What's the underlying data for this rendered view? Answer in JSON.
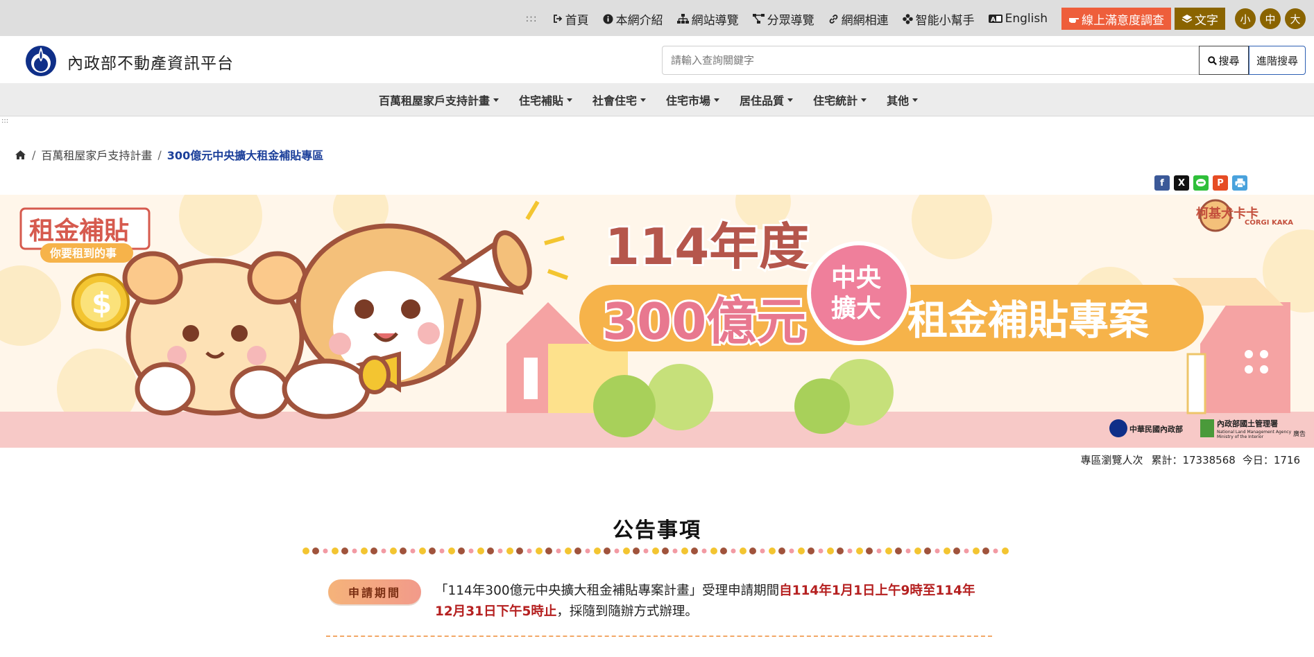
{
  "topbar": {
    "sep": ":::",
    "links": [
      {
        "label": "首頁",
        "icon": "sign-in-icon"
      },
      {
        "label": "本網介紹",
        "icon": "info-circle-icon"
      },
      {
        "label": "網站導覽",
        "icon": "sitemap-icon"
      },
      {
        "label": "分眾導覽",
        "icon": "network-icon"
      },
      {
        "label": "網網相連",
        "icon": "link-icon"
      },
      {
        "label": "智能小幫手",
        "icon": "helper-icon"
      },
      {
        "label": "English",
        "icon": "language-icon"
      }
    ],
    "survey": "線上滿意度調查",
    "text_mode": "文字",
    "font_sizes": [
      "小",
      "中",
      "大"
    ]
  },
  "header": {
    "site_title": "內政部不動產資訊平台",
    "search_placeholder": "請輸入查詢關鍵字",
    "search_label": "搜尋",
    "advanced_label": "進階搜尋"
  },
  "nav": {
    "items": [
      "百萬租屋家戶支持計畫",
      "住宅補貼",
      "社會住宅",
      "住宅市場",
      "居住品質",
      "住宅統計",
      "其他"
    ]
  },
  "breadcrumb": {
    "parent": "百萬租屋家戶支持計畫",
    "current": "300億元中央擴大租金補貼專區"
  },
  "share": {
    "facebook": "f",
    "x": "X",
    "plurk": "P"
  },
  "banner": {
    "logo_line1": "租金補貼",
    "logo_line2": "你要租到的事",
    "corgi_cn": "柯基犬卡卡",
    "corgi_en": "CORGI KAKA",
    "year": "114年度",
    "amount": "300億元",
    "bubble_line1": "中央",
    "bubble_line2": "擴大",
    "project": "租金補貼專案",
    "org1": "中華民國內政部",
    "org2": "內政部國土管理署",
    "org2_en1": "National Land Management Agency",
    "org2_en2": "Ministry of the Interior",
    "ad": "廣告"
  },
  "visits": {
    "label": "專區瀏覽人次",
    "total": "累計：17338568",
    "today": "今日：1716"
  },
  "announcement": {
    "title": "公告事項",
    "badge": "申請期間",
    "text_pre": "「114年300億元中央擴大租金補貼專案計畫」受理申請期間",
    "text_hl": "自114年1月1日上午9時至114年12月31日下午5時止",
    "text_post": "，採隨到隨辦方式辦理。"
  },
  "colors": {
    "survey_bg": "#ee5e3b",
    "gold": "#8a6400",
    "banner_title": "#b5564c",
    "banner_pink": "#e8788f",
    "banner_orange": "#f6b34a",
    "highlight": "#b52020"
  }
}
